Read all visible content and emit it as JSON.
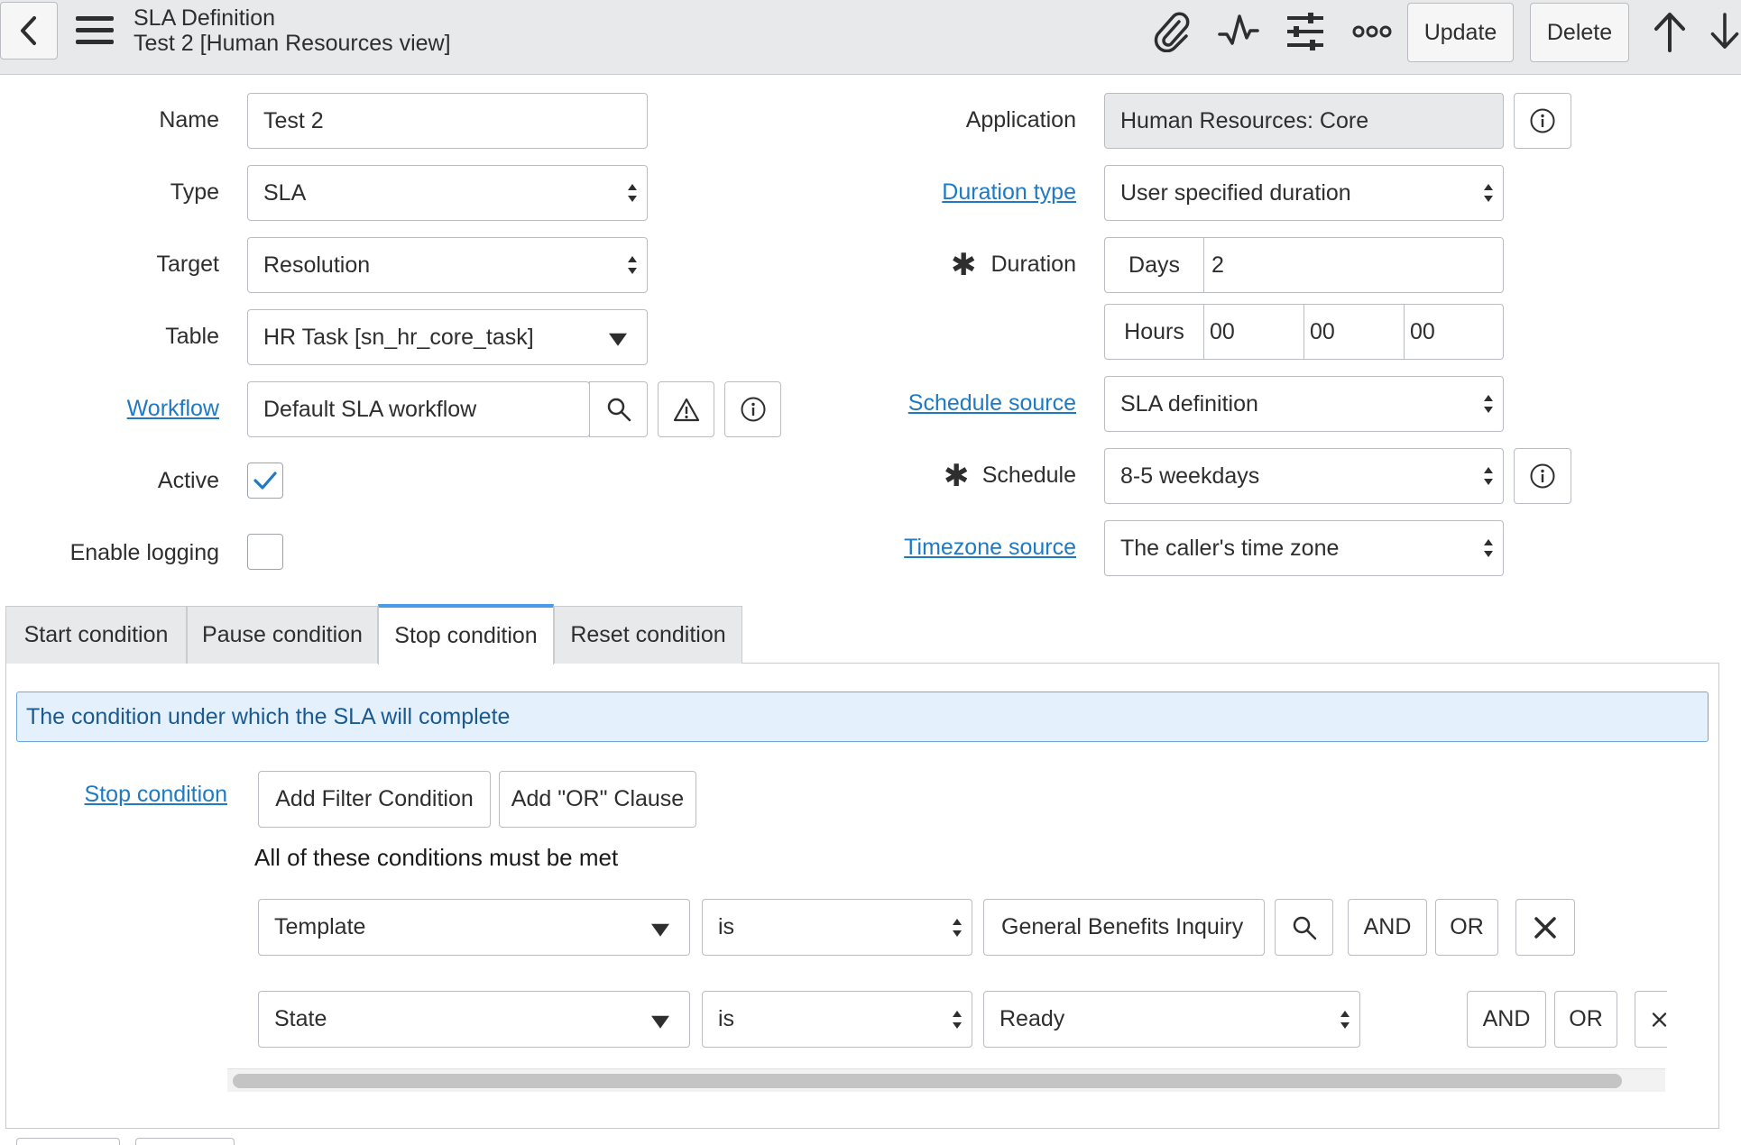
{
  "header": {
    "title": "SLA Definition",
    "subtitle": "Test 2 [Human Resources view]",
    "update_label": "Update",
    "delete_label": "Delete"
  },
  "form": {
    "name_label": "Name",
    "name_value": "Test 2",
    "type_label": "Type",
    "type_value": "SLA",
    "target_label": "Target",
    "target_value": "Resolution",
    "table_label": "Table",
    "table_value": "HR Task [sn_hr_core_task]",
    "workflow_label": "Workflow",
    "workflow_value": "Default SLA workflow",
    "active_label": "Active",
    "active_checked": true,
    "logging_label": "Enable logging",
    "logging_checked": false,
    "application_label": "Application",
    "application_value": "Human Resources: Core",
    "duration_type_label": "Duration type",
    "duration_type_value": "User specified duration",
    "duration_label": "Duration",
    "days_label": "Days",
    "days_value": "2",
    "hours_label": "Hours",
    "hours_value": "00",
    "minutes_value": "00",
    "seconds_value": "00",
    "schedule_source_label": "Schedule source",
    "schedule_source_value": "SLA definition",
    "schedule_label": "Schedule",
    "schedule_value": "8-5 weekdays",
    "timezone_source_label": "Timezone source",
    "timezone_source_value": "The caller's time zone"
  },
  "tabs": [
    {
      "label": "Start condition"
    },
    {
      "label": "Pause condition"
    },
    {
      "label": "Stop condition"
    },
    {
      "label": "Reset condition"
    }
  ],
  "active_tab": "Stop condition",
  "condition": {
    "banner": "The condition under which the SLA will complete",
    "field_label": "Stop condition",
    "add_filter_label": "Add Filter Condition",
    "add_or_label": "Add \"OR\" Clause",
    "all_met_text": "All of these conditions must be met",
    "rows": [
      {
        "field": "Template",
        "operator": "is",
        "value": "General Benefits Inquiry",
        "and": "AND",
        "or": "OR"
      },
      {
        "field": "State",
        "operator": "is",
        "value": "Ready",
        "and": "AND",
        "or": "OR"
      }
    ]
  },
  "colors": {
    "accent": "#1f7ac3",
    "header_bg": "#e8e9ea",
    "banner_bg": "#e4f0fb",
    "tab_active_border": "#4a9ce8"
  }
}
